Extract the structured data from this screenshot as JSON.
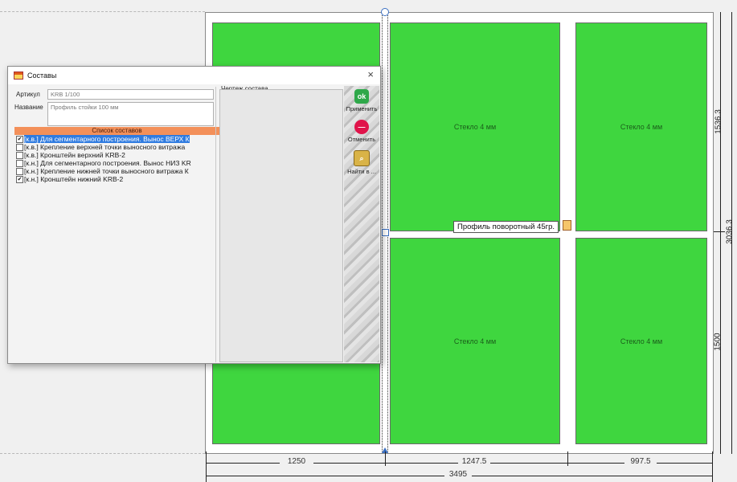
{
  "canvas": {
    "panes": [
      {
        "label": "Стекло 4 мм"
      },
      {
        "label": "Стекло 4 мм"
      },
      {
        "label": "Стекло 4 мм"
      },
      {
        "label": "Стекло 4 мм"
      }
    ],
    "tooltip": "Профиль поворотный 45гр.",
    "dimensions": {
      "bottom": [
        "1250",
        "1247.5",
        "997.5"
      ],
      "total": "3495",
      "right_top": "1536.3",
      "right_bottom": "1500",
      "right_total": "3036.3"
    },
    "colors": {
      "glass": "#3fd63f",
      "selection": "#2f7be0",
      "list_header": "#f3905a"
    }
  },
  "dialog": {
    "title": "Составы",
    "article_label": "Артикул",
    "article_value": "KRB 1/100",
    "name_label": "Название",
    "name_value": "Профиль стойки 100 мм",
    "list_header": "Список составов",
    "items": [
      {
        "text": "[к.в.] Для сегментарного построения. Вынос ВЕРХ К",
        "checked": true,
        "selected": true
      },
      {
        "text": "[к.в.] Крепление верхней точки выносного витража",
        "checked": false,
        "selected": false
      },
      {
        "text": "[к.в.] Кронштейн верхний KRB-2",
        "checked": false,
        "selected": false
      },
      {
        "text": "[к.н.] Для сегментарного построения. Вынос НИЗ KR",
        "checked": false,
        "selected": false
      },
      {
        "text": "[к.н.] Крепление нижней точки выносного витража К",
        "checked": false,
        "selected": false
      },
      {
        "text": "[к.н.] Кронштейн нижний KRB-2",
        "checked": true,
        "selected": false
      }
    ],
    "drawing_label": "Чертеж состава",
    "buttons": {
      "apply": "Применить",
      "cancel": "Отменить",
      "find": "Найти в ..."
    }
  }
}
